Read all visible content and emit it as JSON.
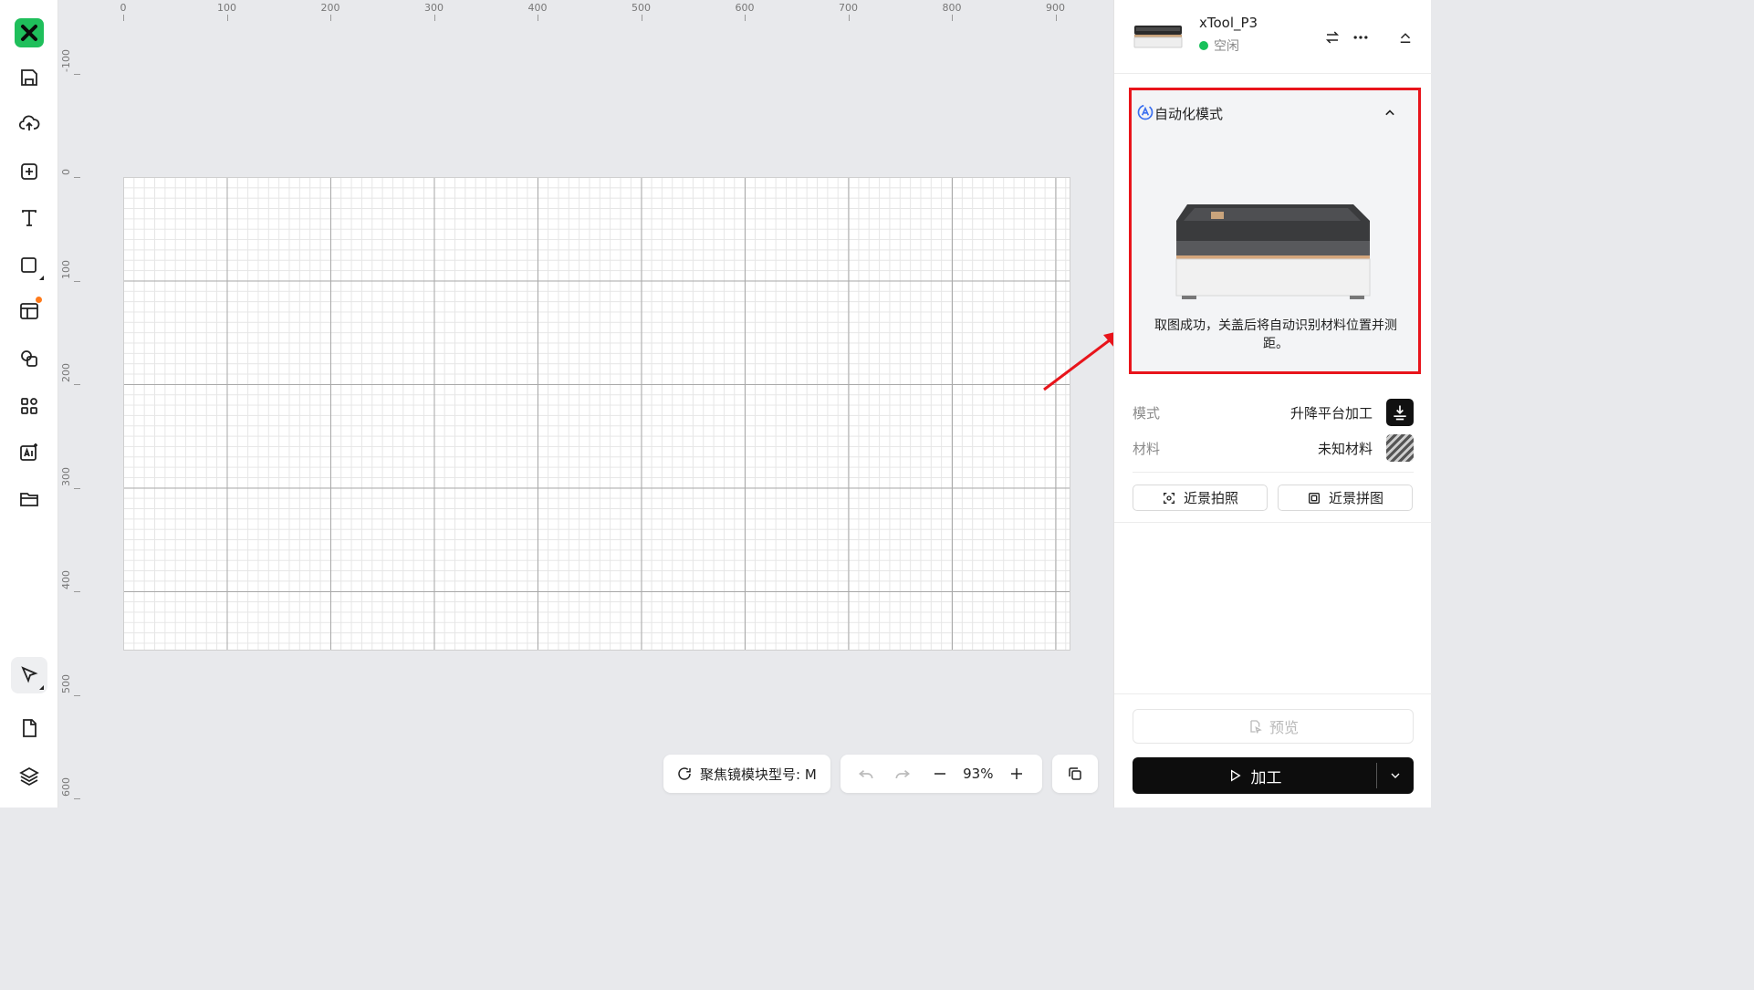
{
  "ruler": {
    "x_labels": [
      "0",
      "100",
      "200",
      "300",
      "400",
      "500",
      "600",
      "700",
      "800",
      "900"
    ],
    "y_labels": [
      "-100",
      "0",
      "100",
      "200",
      "300",
      "400",
      "500",
      "600"
    ]
  },
  "toolbar": {
    "tools": [
      "save-icon",
      "upload-cloud-icon",
      "add-square-icon",
      "text-tool-icon",
      "shape-tool-icon",
      "template-icon",
      "combine-icon",
      "apps-icon",
      "ai-icon",
      "folder-icon",
      "select-tool-icon",
      "document-icon",
      "layers-icon"
    ]
  },
  "bottom_bar": {
    "focus_label": "聚焦镜模块型号: M",
    "zoom_value": "93%"
  },
  "device": {
    "name": "xTool_P3",
    "status": "空闲",
    "status_color": "#18c15a"
  },
  "auto_mode": {
    "title": "自动化模式",
    "message": "取图成功，关盖后将自动识别材料位置并测距。",
    "highlight_color": "#e8141b"
  },
  "settings": {
    "mode_label": "模式",
    "mode_value": "升降平台加工",
    "material_label": "材料",
    "material_value": "未知材料"
  },
  "buttons": {
    "closeup_photo": "近景拍照",
    "closeup_stitch": "近景拼图",
    "preview": "预览",
    "process": "加工"
  },
  "colors": {
    "brand": "#1fbf5b",
    "accent_dot": "#ff7a1a",
    "primary_button": "#0d0d0d"
  }
}
